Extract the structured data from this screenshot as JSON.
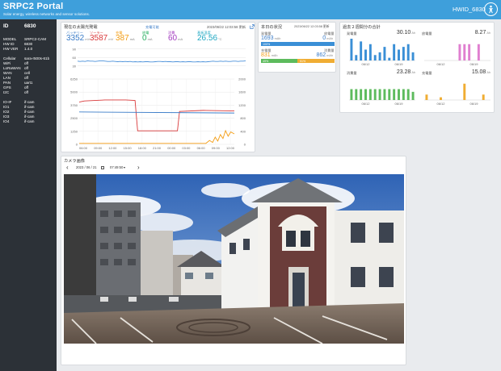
{
  "header": {
    "title": "SRPC2 Portal",
    "subtitle": "Solar energy, wireless networks and sensor solutions.",
    "hwid": "HWID_6830"
  },
  "sidebar": {
    "id_label": "ID",
    "id_value": "6830",
    "rows": [
      {
        "k": "MODEL",
        "v": "SRPC2-CAM"
      },
      {
        "k": "HW ID",
        "v": "6830"
      },
      {
        "k": "HW VER",
        "v": "1.4.0"
      },
      {
        "k": "Cellular",
        "v": "sara-r500s-61b"
      },
      {
        "k": "WiFi",
        "v": "off"
      },
      {
        "k": "LoRaWAN",
        "v": "off"
      },
      {
        "k": "WAN",
        "v": "cell"
      },
      {
        "k": "LAN",
        "v": "off"
      },
      {
        "k": "PAN",
        "v": "uart1"
      },
      {
        "k": "GPS",
        "v": "off"
      },
      {
        "k": "I2C",
        "v": "off"
      },
      {
        "k": "IO-IF",
        "v": "if-cam"
      },
      {
        "k": "IO1",
        "v": "if-cam"
      },
      {
        "k": "IO2",
        "v": "if-cam"
      },
      {
        "k": "IO3",
        "v": "if-cam"
      },
      {
        "k": "IO4",
        "v": "if-cam"
      }
    ]
  },
  "solar": {
    "title": "現在の太陽光発電",
    "charge_state": "充電可能",
    "updated": "2023/06/22 12:03:58 更新",
    "metrics": [
      {
        "label": "バッテリー",
        "value": "3352",
        "unit": "mV",
        "color": "#3a7cc8"
      },
      {
        "label": "ソーラー",
        "value": "3587",
        "unit": "mV",
        "color": "#d9393a"
      },
      {
        "label": "充電",
        "value": "387",
        "unit": "mA",
        "color": "#f39c12"
      },
      {
        "label": "放電",
        "value": "0",
        "unit": "mA",
        "color": "#27ae60"
      },
      {
        "label": "消費",
        "value": "60",
        "unit": "mA",
        "color": "#a23bbf"
      },
      {
        "label": "基板温度",
        "value": "26.56",
        "unit": "°C",
        "color": "#1fa7c2"
      }
    ]
  },
  "temp_chart": {
    "y_ticks": [
      "90",
      "60",
      "30"
    ],
    "ylim": [
      15,
      95
    ],
    "values": [
      47,
      46,
      47,
      46,
      48,
      47,
      47,
      46,
      47,
      48,
      48,
      47,
      46,
      46,
      47,
      46,
      45,
      46,
      45,
      46,
      45,
      46,
      44,
      45,
      44,
      45,
      44,
      45,
      45,
      44,
      44,
      45,
      46,
      46,
      45,
      46,
      45,
      45,
      44,
      45,
      45,
      44,
      45,
      44,
      45,
      45,
      44,
      44,
      45,
      44,
      45,
      44,
      45,
      46,
      47,
      46,
      46,
      47,
      46,
      47,
      46,
      46,
      47,
      47,
      46,
      47,
      47,
      48
    ]
  },
  "power_chart": {
    "left_ticks": [
      "6250",
      "5000",
      "3750",
      "2500",
      "1250",
      "0"
    ],
    "right_ticks": [
      "2000",
      "1600",
      "1200",
      "800",
      "400",
      "0"
    ],
    "x_ticks": [
      "06:00",
      "09:00",
      "12:00",
      "15:00",
      "18:00",
      "21:00",
      "00:00",
      "03:00",
      "06:00",
      "09:00",
      "12:00"
    ],
    "x_range": [
      0,
      30
    ],
    "left_range": [
      0,
      6250
    ],
    "right_range": [
      0,
      2000
    ],
    "series": [
      {
        "color": "#d9393a",
        "axis": "left",
        "points": [
          [
            0,
            4050
          ],
          [
            1,
            4150
          ],
          [
            3,
            4200
          ],
          [
            5,
            4250
          ],
          [
            7,
            4250
          ],
          [
            9,
            4250
          ],
          [
            10.8,
            4200
          ],
          [
            11.3,
            1300
          ],
          [
            16,
            1300
          ],
          [
            18,
            1300
          ],
          [
            19,
            1300
          ],
          [
            19.4,
            3150
          ],
          [
            24,
            3250
          ],
          [
            30,
            3200
          ]
        ]
      },
      {
        "color": "#3a7cc8",
        "axis": "left",
        "points": [
          [
            0,
            3100
          ],
          [
            30,
            3000
          ]
        ]
      },
      {
        "color": "#f39c12",
        "axis": "right",
        "points": [
          [
            0,
            30
          ],
          [
            24.5,
            30
          ],
          [
            25.2,
            120
          ],
          [
            25.8,
            60
          ],
          [
            26.3,
            220
          ],
          [
            26.8,
            100
          ],
          [
            27.3,
            300
          ],
          [
            27.8,
            180
          ],
          [
            28.3,
            420
          ],
          [
            28.8,
            250
          ],
          [
            29.3,
            380
          ],
          [
            30,
            320
          ]
        ]
      }
    ]
  },
  "today": {
    "title": "本日の状況",
    "updated": "2023/06/22 12:03:58 更新",
    "gen_label": "発電量",
    "gen_value": "1693",
    "gen_unit": "mAh",
    "dis_label": "放電量",
    "dis_value": "0",
    "dis_unit": "mAh",
    "bar1_text": "100%",
    "chg_label": "充電量",
    "chg_value": "831",
    "chg_unit": "mAh",
    "con_label": "消費量",
    "con_value": "862",
    "con_unit": "mAh",
    "bar2_left": "49%",
    "bar2_right": "51%",
    "bar1_fraction": 1.0,
    "bar2_fraction": 0.49
  },
  "two_week": {
    "title": "過去２週間分の合計",
    "panels": [
      {
        "label": "発電量",
        "value": "30.10",
        "unit": "Ah",
        "color": "#3a8fd6",
        "dates": [
          "06/12",
          "06/19"
        ],
        "values": [
          4,
          1,
          3.5,
          2,
          3,
          1,
          1.5,
          2.5,
          0.5,
          3,
          2,
          2.5,
          3,
          1.5
        ]
      },
      {
        "label": "放電量",
        "value": "8.27",
        "unit": "Ah",
        "color": "#e07fd0",
        "dates": [
          "06/12",
          "06/19"
        ],
        "values": [
          0,
          0,
          0,
          0,
          0,
          0,
          0,
          3,
          3,
          3,
          0,
          3,
          0,
          0
        ]
      },
      {
        "label": "消費量",
        "value": "23.28",
        "unit": "Ah",
        "color": "#5dbb5d",
        "dates": [
          "06/12",
          "06/19"
        ],
        "values": [
          2,
          2,
          2,
          2,
          2,
          2,
          2,
          2,
          2,
          2,
          2,
          2,
          2,
          1.5
        ]
      },
      {
        "label": "充電量",
        "value": "15.08",
        "unit": "Ah",
        "color": "#f0ad33",
        "dates": [
          "06/12",
          "06/19"
        ],
        "values": [
          1,
          0,
          0,
          0.5,
          0,
          0,
          0,
          0,
          3,
          0,
          0,
          0,
          1,
          0
        ]
      }
    ]
  },
  "camera": {
    "title": "カメラ画像",
    "prev": "‹",
    "date_value": "2023 / 06 / 21",
    "time_value": "07:49:50",
    "next": "›"
  }
}
